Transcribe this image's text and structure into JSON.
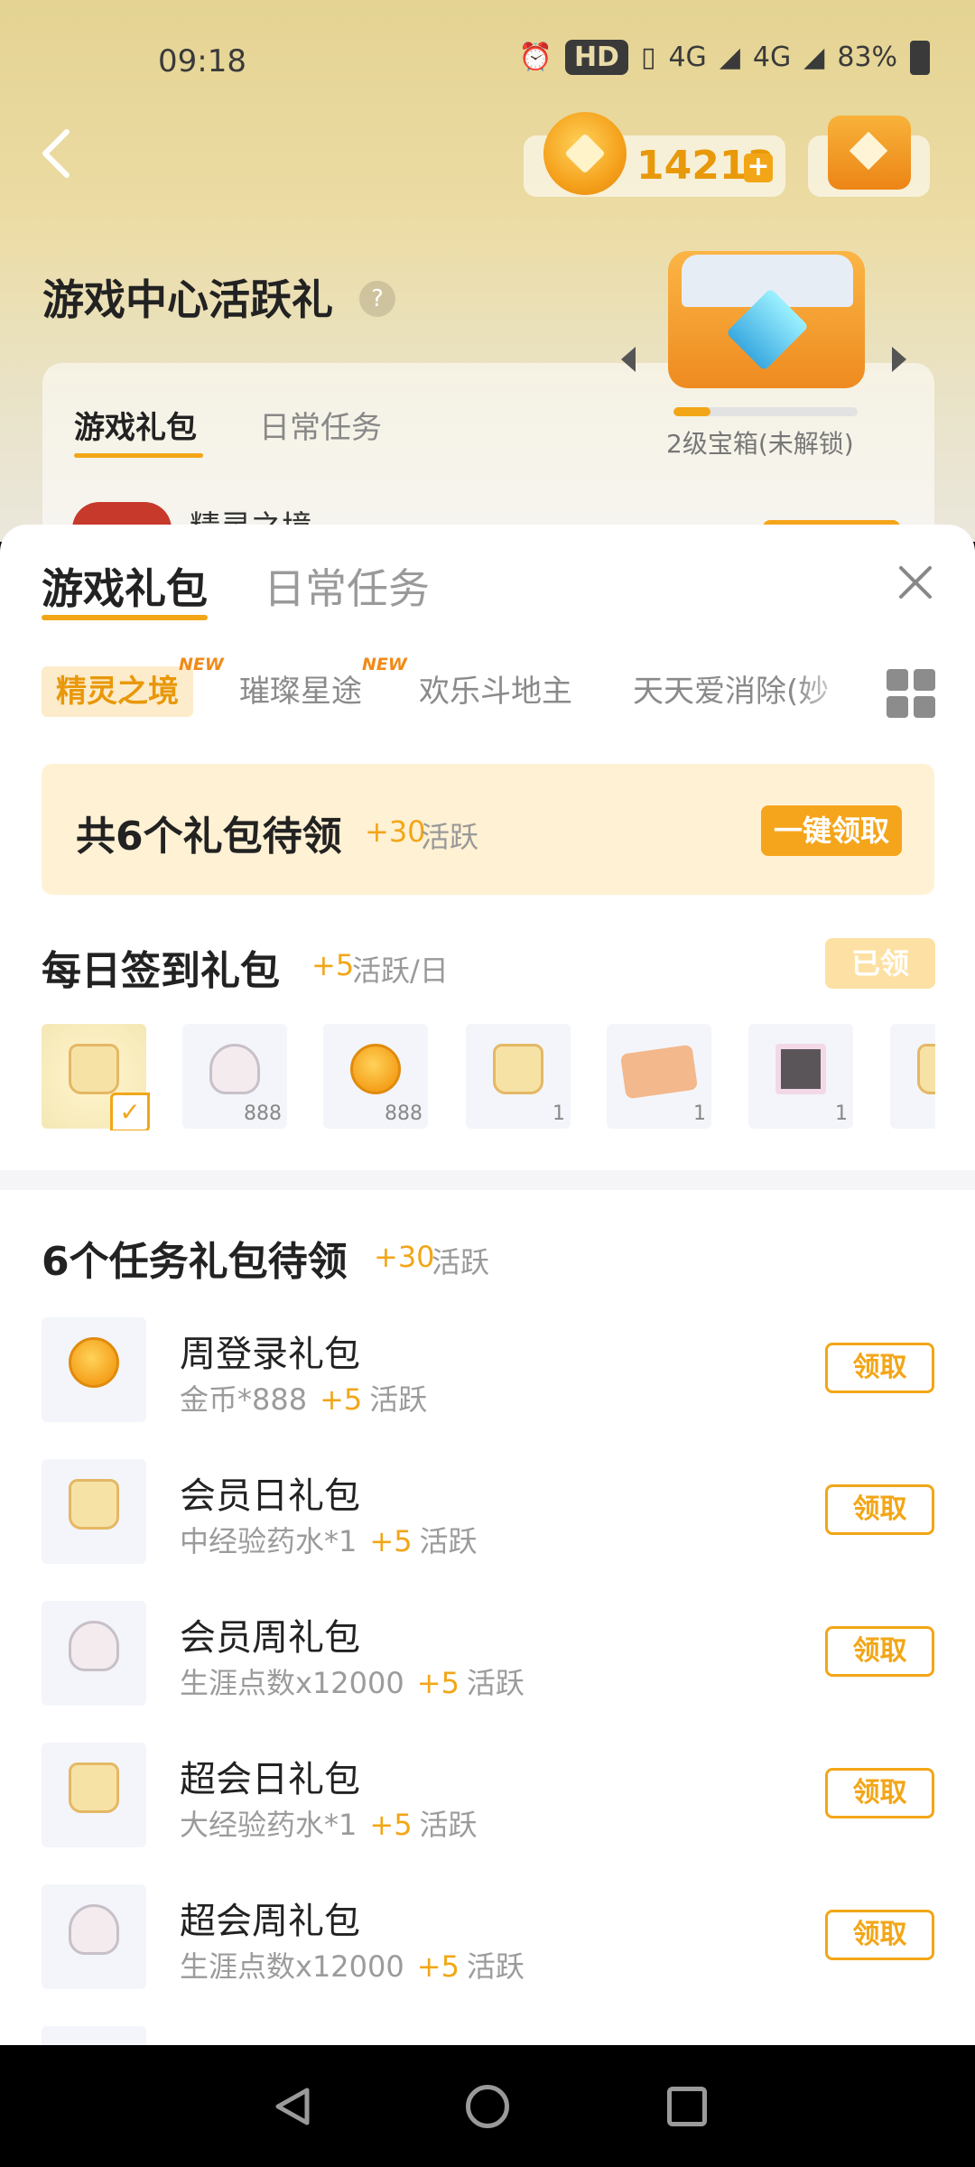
{
  "status_bar": {
    "time": "09:18",
    "hd": "HD",
    "network_1": "4G",
    "network_2": "4G",
    "battery": "83%"
  },
  "header": {
    "coin_amount": "14213",
    "coin_plus": "+"
  },
  "background": {
    "title": "游戏中心活跃礼",
    "help": "?",
    "tabs": [
      "游戏礼包",
      "日常任务"
    ],
    "game_name": "精灵之境",
    "chest_label": "2级宝箱(未解锁)",
    "chest_progress": 0.2
  },
  "sheet": {
    "tabs": [
      "游戏礼包",
      "日常任务"
    ],
    "game_tabs": [
      {
        "label": "精灵之境",
        "badge": "NEW"
      },
      {
        "label": "璀璨星途",
        "badge": "NEW"
      },
      {
        "label": "欢乐斗地主",
        "badge": ""
      },
      {
        "label": "天天爱消除(妙",
        "badge": ""
      }
    ],
    "banner": {
      "text": "共6个礼包待领",
      "plus": "+30",
      "active": "活跃",
      "button": "一键领取"
    },
    "signin": {
      "title": "每日签到礼包",
      "plus": "+5",
      "unit": "活跃/日",
      "claimed": "已领",
      "rewards": [
        {
          "icon": "potion-bottle-icon",
          "count": ""
        },
        {
          "icon": "shell-icon",
          "count": "888"
        },
        {
          "icon": "star-coin-icon",
          "count": "888"
        },
        {
          "icon": "potion-bottle-icon",
          "count": "1"
        },
        {
          "icon": "ticket-icon",
          "count": "1"
        },
        {
          "icon": "photo-frame-icon",
          "count": "1"
        },
        {
          "icon": "potion-bottle-icon",
          "count": ""
        }
      ]
    },
    "tasks": {
      "title": "6个任务礼包待领",
      "plus": "+30",
      "active": "活跃",
      "items": [
        {
          "name": "周登录礼包",
          "desc": "金币*888",
          "plus": "+5",
          "active": "活跃",
          "button": "领取",
          "icon": "star-coin-icon"
        },
        {
          "name": "会员日礼包",
          "desc": "中经验药水*1",
          "plus": "+5",
          "active": "活跃",
          "button": "领取",
          "icon": "potion-bottle-icon"
        },
        {
          "name": "会员周礼包",
          "desc": "生涯点数x12000",
          "plus": "+5",
          "active": "活跃",
          "button": "领取",
          "icon": "shell-icon"
        },
        {
          "name": "超会日礼包",
          "desc": "大经验药水*1",
          "plus": "+5",
          "active": "活跃",
          "button": "领取",
          "icon": "potion-bottle-icon"
        },
        {
          "name": "超会周礼包",
          "desc": "生涯点数x12000",
          "plus": "+5",
          "active": "活跃",
          "button": "领取",
          "icon": "shell-icon"
        }
      ]
    }
  },
  "colors": {
    "accent": "#f2a617",
    "banner_bg": "#fff1d4",
    "claimed_bg": "#fde1a4"
  }
}
